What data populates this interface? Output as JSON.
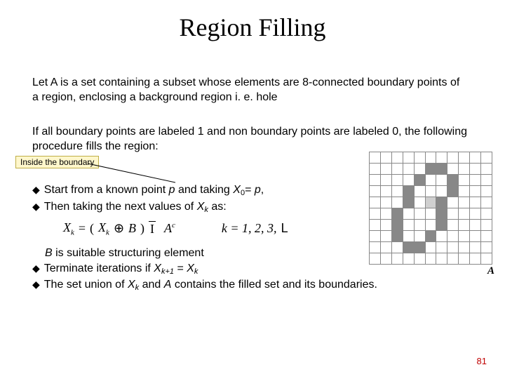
{
  "title": "Region Filling",
  "para1": "Let A is a set containing a subset whose elements are 8-connected boundary points of a region, enclosing a background region i. e. hole",
  "para2": "If all boundary points are labeled 1 and non boundary points are labeled 0, the following procedure fills the region:",
  "callout": "Inside the boundary",
  "bullet1_pre": "Start from a known point ",
  "bullet1_var_p1": "p",
  "bullet1_mid": " and taking ",
  "bullet1_varX": "X",
  "bullet1_sub0": "0",
  "bullet1_eq": "= ",
  "bullet1_var_p2": "p",
  "bullet1_comma": ",",
  "bullet2_pre": "Then taking the next values of ",
  "bullet2_varX": "X",
  "bullet2_subk": "k",
  "bullet2_post": " as:",
  "formula": {
    "Xk": "X",
    "k": "k",
    "eq": "=",
    "lp": "(",
    "Xk2": "X",
    "k2": "k",
    "oplus": "⊕",
    "B": "B",
    "rp": ")",
    "I": "I",
    "A": "A",
    "c": "c",
    "klist": "k = 1, 2, 3,",
    "L": "L"
  },
  "bullet3_pre": "B",
  "bullet3_post": " is suitable structuring element",
  "bullet4_pre": "Terminate iterations if ",
  "bullet4_X1": "X",
  "bullet4_sub1": "k+1",
  "bullet4_eq2": " = ",
  "bullet4_X2": "X",
  "bullet4_sub2": "k",
  "bullet5_pre": "The set union of ",
  "bullet5_X": "X",
  "bullet5_subk": "k",
  "bullet5_mid": " and ",
  "bullet5_A": "A",
  "bullet5_post": " contains the filled set and its boundaries.",
  "grid_label": "A",
  "slide_number": "81",
  "grid": [
    [
      0,
      0,
      0,
      0,
      0,
      0,
      0,
      0,
      0,
      0,
      0
    ],
    [
      0,
      0,
      0,
      0,
      0,
      1,
      1,
      0,
      0,
      0,
      0
    ],
    [
      0,
      0,
      0,
      0,
      1,
      0,
      0,
      1,
      0,
      0,
      0
    ],
    [
      0,
      0,
      0,
      1,
      0,
      0,
      0,
      1,
      0,
      0,
      0
    ],
    [
      0,
      0,
      0,
      1,
      0,
      0,
      1,
      0,
      0,
      0,
      0
    ],
    [
      0,
      0,
      1,
      0,
      0,
      0,
      1,
      0,
      0,
      0,
      0
    ],
    [
      0,
      0,
      1,
      0,
      0,
      0,
      1,
      0,
      0,
      0,
      0
    ],
    [
      0,
      0,
      1,
      0,
      0,
      1,
      0,
      0,
      0,
      0,
      0
    ],
    [
      0,
      0,
      0,
      1,
      1,
      0,
      0,
      0,
      0,
      0,
      0
    ],
    [
      0,
      0,
      0,
      0,
      0,
      0,
      0,
      0,
      0,
      0,
      0
    ]
  ],
  "grid_light": [
    [
      4,
      5
    ]
  ]
}
